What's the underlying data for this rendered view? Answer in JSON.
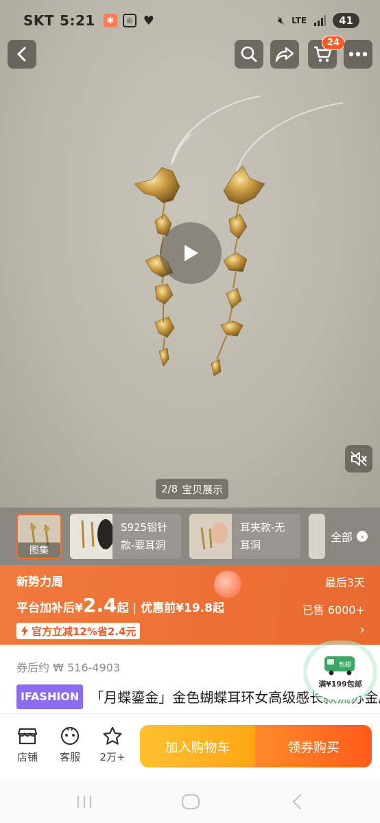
{
  "status_bar": {
    "carrier": "SKT",
    "time": "5:21",
    "network": "LTE",
    "battery": "41"
  },
  "header": {
    "cart_count": "24"
  },
  "media": {
    "counter": "2/8",
    "counter_label": "宝贝展示"
  },
  "thumbnails": {
    "first_label": "图集",
    "items": [
      {
        "label": "S925银针款-要耳洞"
      },
      {
        "label": "耳夹款-无耳洞"
      }
    ],
    "all_label": "全部"
  },
  "promo": {
    "title": "新势力周",
    "countdown": "最后3天",
    "price_prefix": "平台加补后¥",
    "price_big": "2.4",
    "price_suffix": "起",
    "price_sep": "|",
    "original_price": "优惠前¥19.8起",
    "sold": "已售 6000+",
    "coupon": "官方立减12%省2.4元",
    "coupon_icon": "lightning-icon"
  },
  "info": {
    "after_coupon": "券后约 ₩ 516-4903",
    "brand": "IFASHION",
    "title": "「月蝶鎏金」金色蝴蝶耳环女高级感长款流苏金属气质法式耳饰",
    "shipping_badge_label": "包邮",
    "shipping_badge_text": "满¥199包邮"
  },
  "bottom_bar": {
    "store": "店铺",
    "service": "客服",
    "favorites": "2万+",
    "add_to_cart": "加入购物车",
    "buy": "领券购买"
  },
  "colors": {
    "promo_bg": "#ec6f33",
    "cart_button": "#ffb020",
    "buy_button": "#ff5a1a",
    "brand_tag": "#8c6df2",
    "badge": "#ff5a1f"
  }
}
